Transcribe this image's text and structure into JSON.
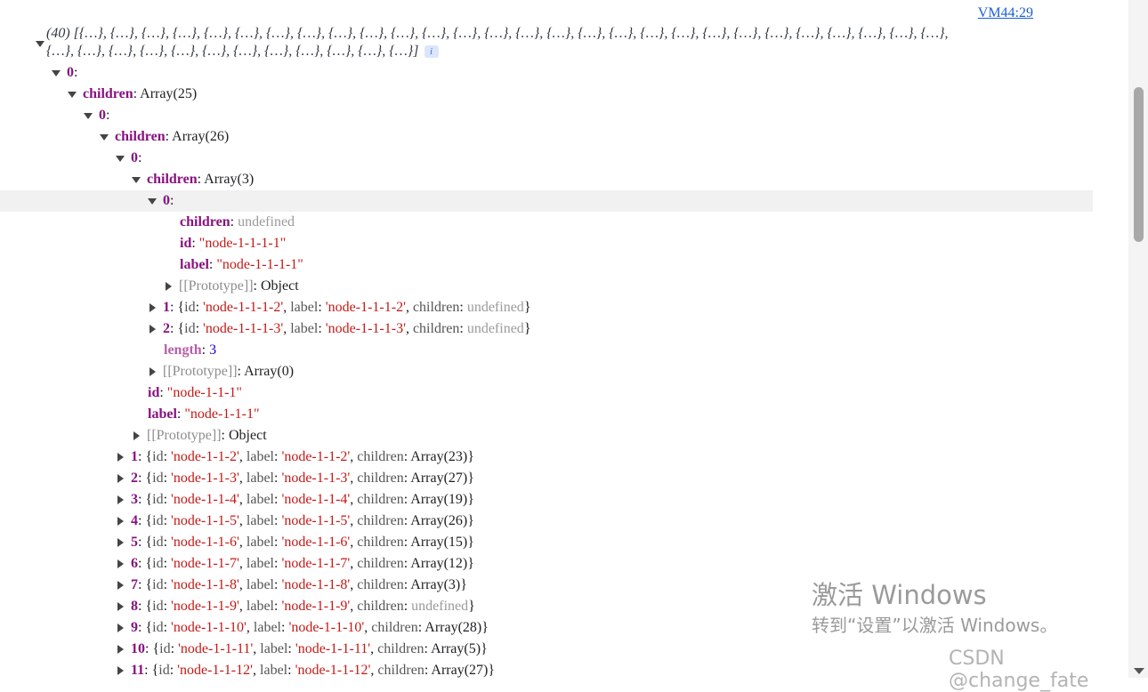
{
  "source_link": "VM44:29",
  "summary": {
    "line1": "(40) [{…}, {…}, {…}, {…}, {…}, {…}, {…}, {…}, {…}, {…}, {…}, {…}, {…}, {…}, {…}, {…}, {…}, {…}, {…}, {…}, {…}, {…}, {…}, {…}, {…}, {…}, {…}, {…},",
    "line2": "{…}, {…}, {…}, {…}, {…}, {…}, {…}, {…}, {…}, {…}, {…}, {…}]",
    "info_badge": "i"
  },
  "tree": {
    "r0": {
      "key": "0",
      "sep": ":"
    },
    "r1": {
      "key": "children",
      "sep": ": ",
      "value": "Array(25)"
    },
    "r2": {
      "key": "0",
      "sep": ":"
    },
    "r3": {
      "key": "children",
      "sep": ": ",
      "value": "Array(26)"
    },
    "r4": {
      "key": "0",
      "sep": ":"
    },
    "r5": {
      "key": "children",
      "sep": ": ",
      "value": "Array(3)"
    },
    "r6": {
      "key": "0",
      "sep": ":"
    },
    "r7": {
      "key": "children",
      "sep": ": ",
      "value": "undefined"
    },
    "r8": {
      "key": "id",
      "sep": ": ",
      "value": "\"node-1-1-1-1\""
    },
    "r9": {
      "key": "label",
      "sep": ": ",
      "value": "\"node-1-1-1-1\""
    },
    "r10": {
      "key": "[[Prototype]]",
      "sep": ": ",
      "value": "Object"
    },
    "r11": {
      "key": "1",
      "open": ": {",
      "id_k": "id",
      "id_v": "'node-1-1-1-2'",
      "lab_k": "label",
      "lab_v": "'node-1-1-1-2'",
      "ch_k": "children",
      "ch_v": "undefined",
      "close": "}"
    },
    "r12": {
      "key": "2",
      "open": ": {",
      "id_k": "id",
      "id_v": "'node-1-1-1-3'",
      "lab_k": "label",
      "lab_v": "'node-1-1-1-3'",
      "ch_k": "children",
      "ch_v": "undefined",
      "close": "}"
    },
    "r13": {
      "key": "length",
      "sep": ": ",
      "value": "3"
    },
    "r14": {
      "key": "[[Prototype]]",
      "sep": ": ",
      "value": "Array(0)"
    },
    "r15": {
      "key": "id",
      "sep": ": ",
      "value": "\"node-1-1-1\""
    },
    "r16": {
      "key": "label",
      "sep": ": ",
      "value": "\"node-1-1-1\""
    },
    "r17": {
      "key": "[[Prototype]]",
      "sep": ": ",
      "value": "Object"
    },
    "r18": {
      "key": "1",
      "open": ": {",
      "id_k": "id",
      "id_v": "'node-1-1-2'",
      "lab_k": "label",
      "lab_v": "'node-1-1-2'",
      "ch_k": "children",
      "ch_v": "Array(23)",
      "close": "}"
    },
    "r19": {
      "key": "2",
      "open": ": {",
      "id_k": "id",
      "id_v": "'node-1-1-3'",
      "lab_k": "label",
      "lab_v": "'node-1-1-3'",
      "ch_k": "children",
      "ch_v": "Array(27)",
      "close": "}"
    },
    "r20": {
      "key": "3",
      "open": ": {",
      "id_k": "id",
      "id_v": "'node-1-1-4'",
      "lab_k": "label",
      "lab_v": "'node-1-1-4'",
      "ch_k": "children",
      "ch_v": "Array(19)",
      "close": "}"
    },
    "r21": {
      "key": "4",
      "open": ": {",
      "id_k": "id",
      "id_v": "'node-1-1-5'",
      "lab_k": "label",
      "lab_v": "'node-1-1-5'",
      "ch_k": "children",
      "ch_v": "Array(26)",
      "close": "}"
    },
    "r22": {
      "key": "5",
      "open": ": {",
      "id_k": "id",
      "id_v": "'node-1-1-6'",
      "lab_k": "label",
      "lab_v": "'node-1-1-6'",
      "ch_k": "children",
      "ch_v": "Array(15)",
      "close": "}"
    },
    "r23": {
      "key": "6",
      "open": ": {",
      "id_k": "id",
      "id_v": "'node-1-1-7'",
      "lab_k": "label",
      "lab_v": "'node-1-1-7'",
      "ch_k": "children",
      "ch_v": "Array(12)",
      "close": "}"
    },
    "r24": {
      "key": "7",
      "open": ": {",
      "id_k": "id",
      "id_v": "'node-1-1-8'",
      "lab_k": "label",
      "lab_v": "'node-1-1-8'",
      "ch_k": "children",
      "ch_v": "Array(3)",
      "close": "}"
    },
    "r25": {
      "key": "8",
      "open": ": {",
      "id_k": "id",
      "id_v": "'node-1-1-9'",
      "lab_k": "label",
      "lab_v": "'node-1-1-9'",
      "ch_k": "children",
      "ch_v": "undefined",
      "close": "}"
    },
    "r26": {
      "key": "9",
      "open": ": {",
      "id_k": "id",
      "id_v": "'node-1-1-10'",
      "lab_k": "label",
      "lab_v": "'node-1-1-10'",
      "ch_k": "children",
      "ch_v": "Array(28)",
      "close": "}"
    },
    "r27": {
      "key": "10",
      "open": ": {",
      "id_k": "id",
      "id_v": "'node-1-1-11'",
      "lab_k": "label",
      "lab_v": "'node-1-1-11'",
      "ch_k": "children",
      "ch_v": "Array(5)",
      "close": "}"
    },
    "r28": {
      "key": "11",
      "open": ": {",
      "id_k": "id",
      "id_v": "'node-1-1-12'",
      "lab_k": "label",
      "lab_v": "'node-1-1-12'",
      "ch_k": "children",
      "ch_v": "Array(27)",
      "close": "}"
    }
  },
  "sep_comma": ", ",
  "sep_colon": ": ",
  "activation": {
    "title": "激活 Windows",
    "subtitle": "转到“设置”以激活 Windows。"
  },
  "watermark": "CSDN @change_fate"
}
